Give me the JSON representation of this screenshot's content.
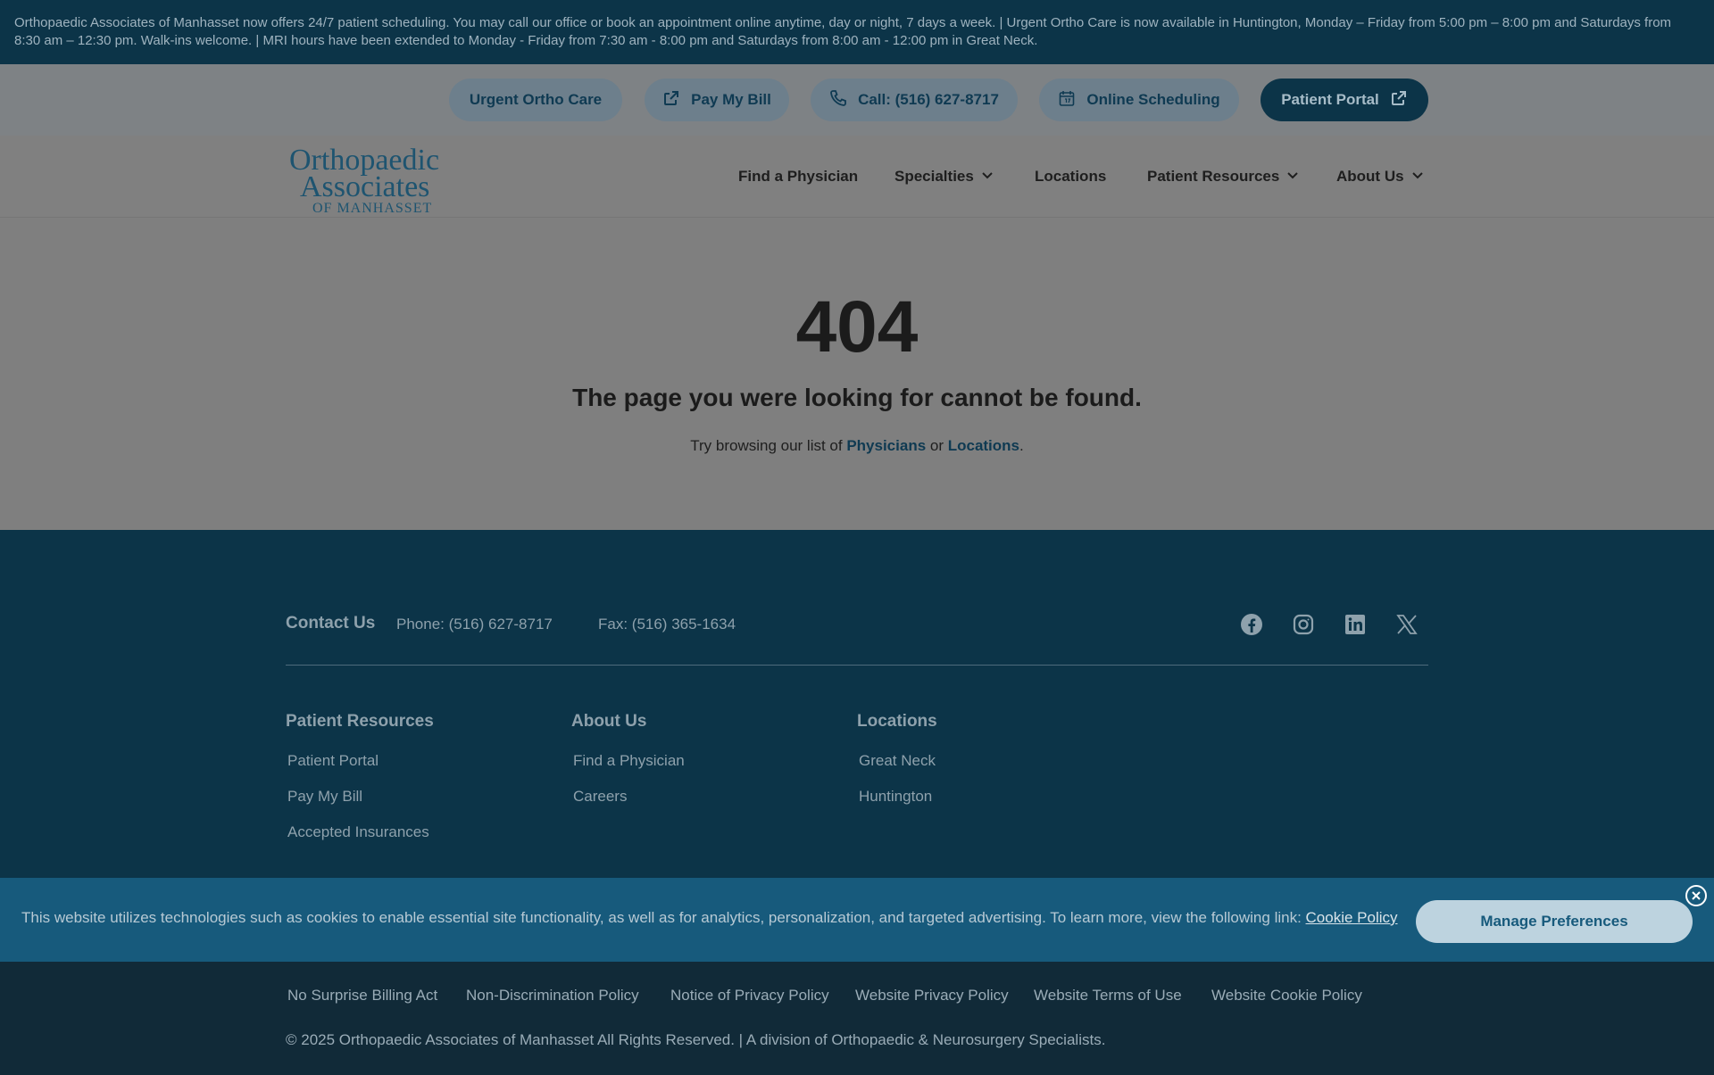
{
  "announcement": "Orthopaedic Associates of Manhasset now offers 24/7 patient scheduling. You may call our office or book an appointment online anytime, day or night, 7 days a week. | Urgent Ortho Care is now available in Huntington, Monday – Friday from 5:00 pm – 8:00 pm and Saturdays from 8:30 am – 12:30 pm. Walk-ins welcome. | MRI hours have been extended to Monday - Friday from 7:30 am - 8:00 pm and Saturdays from 8:00 am - 12:00 pm in Great Neck.",
  "utility": {
    "urgent": "Urgent Ortho Care",
    "pay_bill": "Pay My Bill",
    "call": "Call: (516) 627-8717",
    "scheduling": "Online Scheduling",
    "portal": "Patient Portal"
  },
  "logo": {
    "line1": "Orthopaedic",
    "line2": "Associates",
    "line3": "OF MANHASSET"
  },
  "nav": {
    "find_physician": "Find a Physician",
    "specialties": "Specialties",
    "locations": "Locations",
    "patient_resources": "Patient Resources",
    "about_us": "About Us"
  },
  "error": {
    "code": "404",
    "message": "The page you were looking for cannot be found.",
    "hint_prefix": "Try browsing our list of ",
    "link_physicians": "Physicians",
    "hint_or": " or ",
    "link_locations": "Locations",
    "hint_suffix": "."
  },
  "footer": {
    "contact_title": "Contact Us",
    "phone": "Phone: (516) 627-8717",
    "fax": "Fax: (516) 365-1634",
    "social": [
      "facebook-icon",
      "instagram-icon",
      "linkedin-icon",
      "x-icon"
    ],
    "columns": {
      "patient_resources": {
        "title": "Patient Resources",
        "links": [
          "Patient Portal",
          "Pay My Bill",
          "Accepted Insurances"
        ]
      },
      "about_us": {
        "title": "About Us",
        "links": [
          "Find a Physician",
          "Careers"
        ]
      },
      "locations": {
        "title": "Locations",
        "links": [
          "Great Neck",
          "Huntington"
        ]
      }
    }
  },
  "cookie": {
    "text": "This website utilizes technologies such as cookies to enable essential site functionality, as well as for analytics, personalization, and targeted advertising. To learn more, view the following link: ",
    "link": "Cookie Policy",
    "button": "Manage Preferences"
  },
  "legal": {
    "links": [
      "No Surprise Billing Act",
      "Non-Discrimination Policy",
      "Notice of Privacy Policy",
      "Website Privacy Policy",
      "Website Terms of Use",
      "Website Cookie Policy"
    ],
    "copyright": "© 2025 Orthopaedic Associates of Manhasset All Rights Reserved. | A division of Orthopaedic & Neurosurgery Specialists."
  },
  "colors": {
    "brand_navy": "#0c3448",
    "cookie_blue": "#175a7c",
    "overlay_gray": "#7f7f7f"
  }
}
